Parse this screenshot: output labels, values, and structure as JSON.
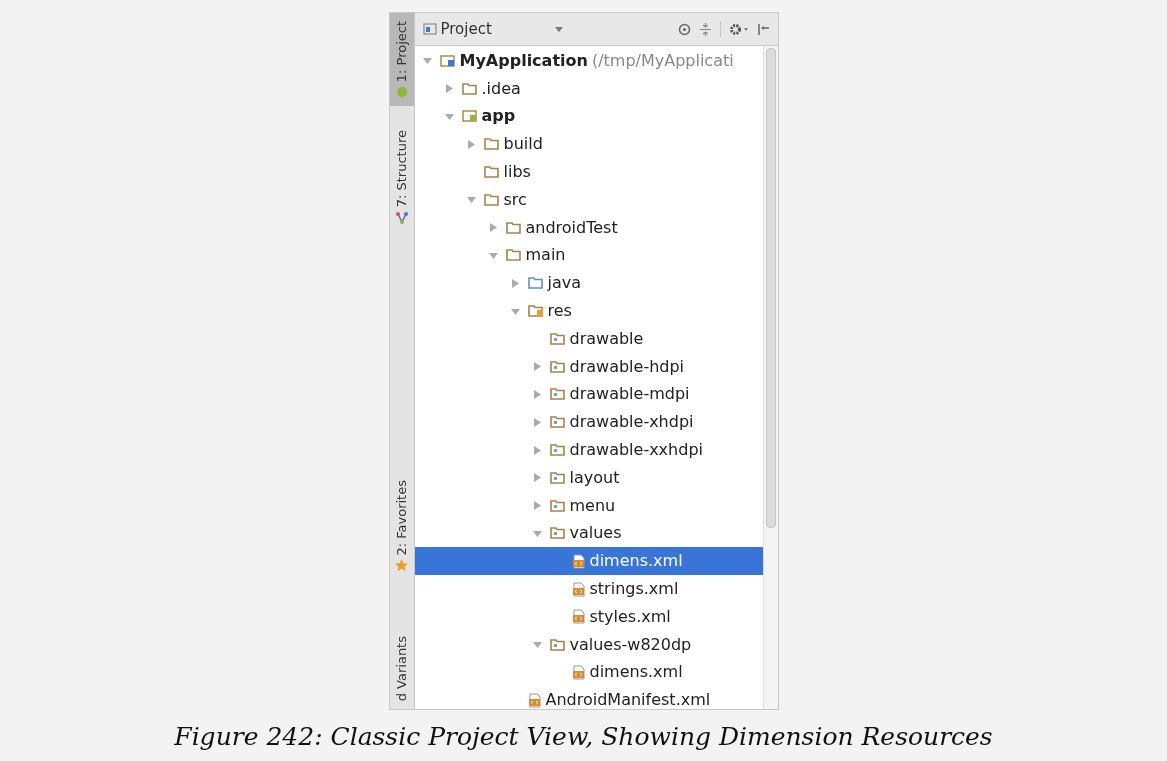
{
  "side_tabs": [
    {
      "label": "1: Project",
      "selected": true
    },
    {
      "label": "7: Structure",
      "selected": false
    },
    {
      "label": "2: Favorites",
      "selected": false
    },
    {
      "label": "d Variants",
      "selected": false
    }
  ],
  "header": {
    "view_selector": "Project"
  },
  "tree": [
    {
      "label": "MyApplication",
      "suffix": "(/tmp/MyApplicati",
      "kind": "project",
      "expandable": true,
      "expanded": true,
      "selected": false,
      "children": [
        {
          "label": ".idea",
          "kind": "folder",
          "expandable": true,
          "expanded": false,
          "selected": false
        },
        {
          "label": "app",
          "kind": "module",
          "expandable": true,
          "expanded": true,
          "selected": false,
          "children": [
            {
              "label": "build",
              "kind": "folder",
              "expandable": true,
              "expanded": false,
              "selected": false
            },
            {
              "label": "libs",
              "kind": "folder",
              "expandable": false,
              "selected": false
            },
            {
              "label": "src",
              "kind": "folder",
              "expandable": true,
              "expanded": true,
              "selected": false,
              "children": [
                {
                  "label": "androidTest",
                  "kind": "folder",
                  "expandable": true,
                  "expanded": false,
                  "selected": false
                },
                {
                  "label": "main",
                  "kind": "folder",
                  "expandable": true,
                  "expanded": true,
                  "selected": false,
                  "children": [
                    {
                      "label": "java",
                      "kind": "source",
                      "expandable": true,
                      "expanded": false,
                      "selected": false
                    },
                    {
                      "label": "res",
                      "kind": "res",
                      "expandable": true,
                      "expanded": true,
                      "selected": false,
                      "children": [
                        {
                          "label": "drawable",
                          "kind": "resfolder",
                          "expandable": false,
                          "selected": false
                        },
                        {
                          "label": "drawable-hdpi",
                          "kind": "resfolder",
                          "expandable": true,
                          "expanded": false,
                          "selected": false
                        },
                        {
                          "label": "drawable-mdpi",
                          "kind": "resfolder",
                          "expandable": true,
                          "expanded": false,
                          "selected": false
                        },
                        {
                          "label": "drawable-xhdpi",
                          "kind": "resfolder",
                          "expandable": true,
                          "expanded": false,
                          "selected": false
                        },
                        {
                          "label": "drawable-xxhdpi",
                          "kind": "resfolder",
                          "expandable": true,
                          "expanded": false,
                          "selected": false
                        },
                        {
                          "label": "layout",
                          "kind": "resfolder",
                          "expandable": true,
                          "expanded": false,
                          "selected": false
                        },
                        {
                          "label": "menu",
                          "kind": "resfolder",
                          "expandable": true,
                          "expanded": false,
                          "selected": false
                        },
                        {
                          "label": "values",
                          "kind": "resfolder",
                          "expandable": true,
                          "expanded": true,
                          "selected": false,
                          "children": [
                            {
                              "label": "dimens.xml",
                              "kind": "file",
                              "expandable": false,
                              "selected": true
                            },
                            {
                              "label": "strings.xml",
                              "kind": "file",
                              "expandable": false,
                              "selected": false
                            },
                            {
                              "label": "styles.xml",
                              "kind": "file",
                              "expandable": false,
                              "selected": false
                            }
                          ]
                        },
                        {
                          "label": "values-w820dp",
                          "kind": "resfolder",
                          "expandable": true,
                          "expanded": true,
                          "selected": false,
                          "children": [
                            {
                              "label": "dimens.xml",
                              "kind": "file",
                              "expandable": false,
                              "selected": false
                            }
                          ]
                        }
                      ]
                    },
                    {
                      "label": "AndroidManifest.xml",
                      "kind": "file",
                      "expandable": false,
                      "selected": false
                    }
                  ]
                }
              ]
            }
          ]
        }
      ]
    }
  ],
  "caption": "Figure 242: Classic Project View, Showing Dimension Resources"
}
